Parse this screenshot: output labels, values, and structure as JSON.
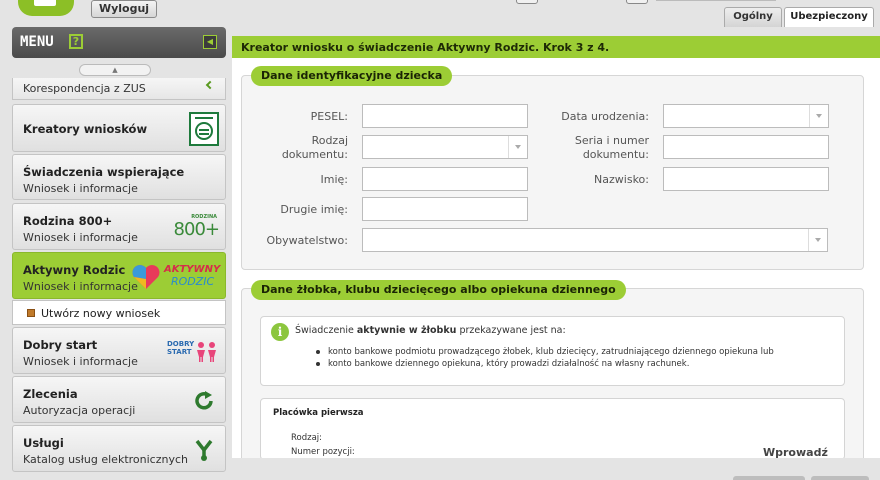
{
  "header": {
    "logout_label": "Wyloguj",
    "tabs": [
      {
        "label": "Ogólny",
        "active": false
      },
      {
        "label": "Ubezpieczony",
        "active": true
      }
    ]
  },
  "sidebar": {
    "menu_title": "MENU",
    "help_label": "?",
    "collapse_icon": "◀",
    "scroll_up_icon": "▲",
    "partial_item_text": "Korespondencja z ZUS",
    "items": [
      {
        "title": "Kreatory wniosków",
        "subtitle": "",
        "icon": "form-wizard-icon"
      },
      {
        "title": "Świadczenia wspierające",
        "subtitle": "Wniosek i informacje",
        "icon": ""
      },
      {
        "title": "Rodzina 800+",
        "subtitle": "Wniosek i informacje",
        "icon": "rodzina-800-logo",
        "logo_small": "RODZINA",
        "logo_big": "800+"
      },
      {
        "title": "Aktywny Rodzic",
        "subtitle": "Wniosek i informacje",
        "icon": "aktywny-rodzic-logo",
        "logo_top": "AKTYWNY",
        "logo_bottom": "RODZIC",
        "active": true
      },
      {
        "title": "Dobry start",
        "subtitle": "Wniosek i informacje",
        "icon": "dobry-start-logo",
        "logo_line1": "DOBRY",
        "logo_line2": "START"
      },
      {
        "title": "Zlecenia",
        "subtitle": "Autoryzacja operacji",
        "icon": "refresh-icon"
      },
      {
        "title": "Usługi",
        "subtitle": "Katalog usług elektronicznych",
        "icon": "services-icon"
      }
    ],
    "sub_action_label": "Utwórz nowy wniosek"
  },
  "main": {
    "title": "Kreator wniosku o świadczenie Aktywny Rodzic. Krok 3 z 4.",
    "section1": {
      "heading": "Dane identyfikacyjne dziecka",
      "fields": {
        "pesel": {
          "label": "PESEL:",
          "value": ""
        },
        "birth_date": {
          "label": "Data urodzenia:",
          "value": ""
        },
        "doc_type": {
          "label": "Rodzaj dokumentu:",
          "value": ""
        },
        "doc_series": {
          "label": "Seria i numer dokumentu:",
          "value": ""
        },
        "first_name": {
          "label": "Imię:",
          "value": ""
        },
        "last_name": {
          "label": "Nazwisko:",
          "value": ""
        },
        "second_name": {
          "label": "Drugie imię:",
          "value": ""
        },
        "citizenship": {
          "label": "Obywatelstwo:",
          "value": ""
        }
      }
    },
    "section2": {
      "heading": "Dane żłobka, klubu dziecięcego albo opiekuna dziennego",
      "info": {
        "text_before": "Świadczenie ",
        "text_bold": "aktywnie w żłobku",
        "text_after": " przekazywane jest na:",
        "bullets": [
          "konto bankowe podmiotu prowadzącego żłobek, klub dziecięcy, zatrudniającego dziennego opiekuna lub",
          "konto bankowe dziennego opiekuna, który prowadzi działalność na własny rachunek."
        ]
      },
      "placowka": {
        "title": "Placówka pierwsza",
        "rodzaj_label": "Rodzaj:",
        "numer_label": "Numer pozycji:",
        "enter_label": "Wprowadź"
      }
    }
  },
  "colors": {
    "accent_green": "#9ccd35",
    "sidebar_header": "#555555",
    "background": "#e4e4e4"
  }
}
